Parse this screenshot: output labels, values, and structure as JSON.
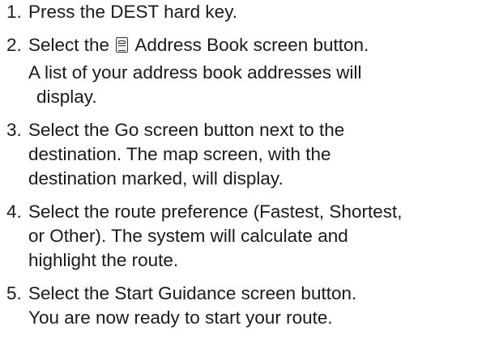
{
  "steps": [
    {
      "number": "1.",
      "lines": [
        "Press the DEST hard key."
      ]
    },
    {
      "number": "2.",
      "text_before_icon": "Select the",
      "icon": "address-book-icon",
      "text_after_icon": "Address Book screen button."
    },
    {
      "number": "3.",
      "lines": [
        "Select the Go screen button next to the",
        "destination. The map screen, with the",
        "destination marked, will display."
      ]
    },
    {
      "number": "4.",
      "lines": [
        "Select the route preference (Fastest, Shortest,",
        "or Other). The system will calculate and",
        "highlight the route."
      ]
    },
    {
      "number": "5.",
      "lines": [
        "Select the Start Guidance screen button.",
        "You are now ready to start your route."
      ]
    }
  ],
  "note": {
    "lines": [
      "A list of your address book addresses will",
      "display."
    ]
  }
}
